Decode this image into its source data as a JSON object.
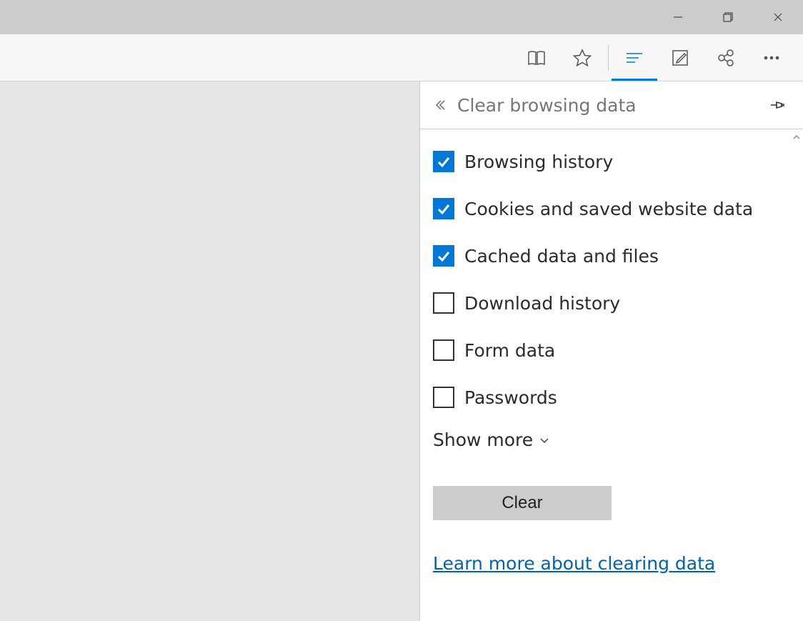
{
  "panel": {
    "title": "Clear browsing data",
    "items": [
      {
        "label": "Browsing history",
        "checked": true
      },
      {
        "label": "Cookies and saved website data",
        "checked": true
      },
      {
        "label": "Cached data and files",
        "checked": true
      },
      {
        "label": "Download history",
        "checked": false
      },
      {
        "label": "Form data",
        "checked": false
      },
      {
        "label": "Passwords",
        "checked": false
      }
    ],
    "show_more": "Show more",
    "clear_button": "Clear",
    "learn_more": "Learn more about clearing data"
  }
}
